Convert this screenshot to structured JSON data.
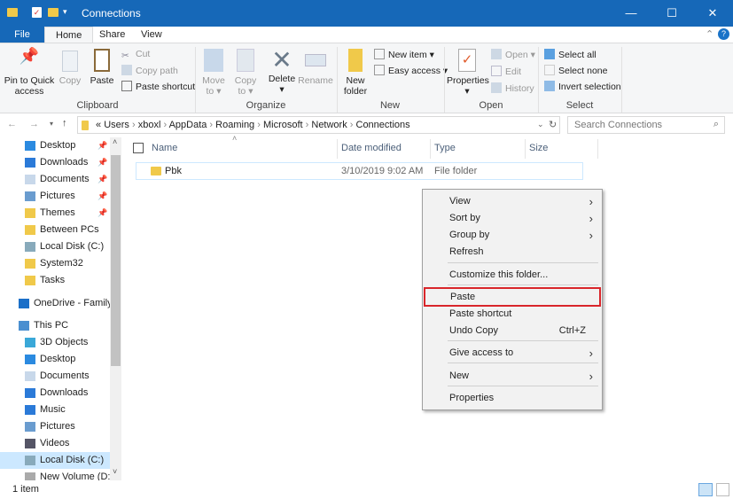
{
  "window": {
    "title": "Connections",
    "minimize": "—",
    "maximize": "☐",
    "close": "✕"
  },
  "ribbon_tabs": [
    "File",
    "Home",
    "Share",
    "View"
  ],
  "ribbon": {
    "clipboard": {
      "label": "Clipboard",
      "pin": "Pin to Quick access",
      "copy": "Copy",
      "paste": "Paste",
      "cut": "Cut",
      "copy_path": "Copy path",
      "paste_shortcut": "Paste shortcut"
    },
    "organize": {
      "label": "Organize",
      "move_to": "Move to",
      "copy_to": "Copy to",
      "delete": "Delete",
      "rename": "Rename"
    },
    "new": {
      "label": "New",
      "new_folder": "New folder",
      "new_item": "New item",
      "easy_access": "Easy access"
    },
    "open": {
      "label": "Open",
      "properties": "Properties",
      "open": "Open",
      "edit": "Edit",
      "history": "History"
    },
    "select": {
      "label": "Select",
      "select_all": "Select all",
      "select_none": "Select none",
      "invert": "Invert selection"
    }
  },
  "address": {
    "path": [
      "«",
      "Users",
      "xboxl",
      "AppData",
      "Roaming",
      "Microsoft",
      "Network",
      "Connections"
    ],
    "search_placeholder": "Search Connections"
  },
  "sidebar": {
    "items": [
      {
        "label": "Desktop",
        "pinned": true,
        "color": "#2b8ae0"
      },
      {
        "label": "Downloads",
        "pinned": true,
        "color": "#2b7ad8"
      },
      {
        "label": "Documents",
        "pinned": true,
        "color": "#c8d8ea"
      },
      {
        "label": "Pictures",
        "pinned": true,
        "color": "#6a9ccf"
      },
      {
        "label": "Themes",
        "pinned": true,
        "color": "#f0c94a"
      },
      {
        "label": "Between PCs",
        "pinned": false,
        "color": "#f0c94a"
      },
      {
        "label": "Local Disk (C:)",
        "pinned": false,
        "color": "#8ab"
      },
      {
        "label": "System32",
        "pinned": false,
        "color": "#f0c94a"
      },
      {
        "label": "Tasks",
        "pinned": false,
        "color": "#f0c94a"
      }
    ],
    "onedrive": "OneDrive - Family",
    "this_pc": "This PC",
    "pc_items": [
      {
        "label": "3D Objects",
        "color": "#3aa8d8"
      },
      {
        "label": "Desktop",
        "color": "#2b8ae0"
      },
      {
        "label": "Documents",
        "color": "#c8d8ea"
      },
      {
        "label": "Downloads",
        "color": "#2b7ad8"
      },
      {
        "label": "Music",
        "color": "#2b7ad8"
      },
      {
        "label": "Pictures",
        "color": "#6a9ccf"
      },
      {
        "label": "Videos",
        "color": "#556"
      },
      {
        "label": "Local Disk (C:)",
        "color": "#8ab",
        "selected": true
      },
      {
        "label": "New Volume (D:)",
        "color": "#aaa"
      }
    ]
  },
  "columns": [
    "Name",
    "Date modified",
    "Type",
    "Size"
  ],
  "files": [
    {
      "name": "Pbk",
      "date": "3/10/2019 9:02 AM",
      "type": "File folder",
      "size": ""
    }
  ],
  "status": "1 item",
  "context_menu": {
    "items": [
      "View",
      "Sort by",
      "Group by",
      "Refresh",
      "Customize this folder...",
      "Paste",
      "Paste shortcut",
      "Undo Copy",
      "Give access to",
      "New",
      "Properties"
    ],
    "undo_shortcut": "Ctrl+Z",
    "highlight_color": "#d9262b"
  }
}
